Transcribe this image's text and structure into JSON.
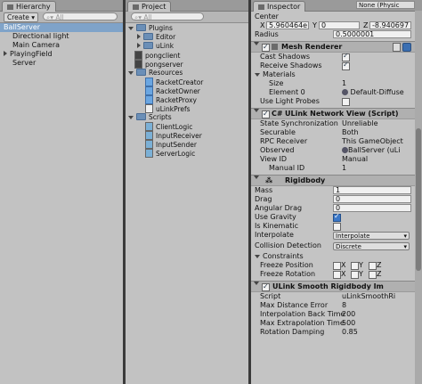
{
  "hierarchy": {
    "tab": "Hierarchy",
    "create": "Create",
    "search_placeholder": "All",
    "items": [
      "BallServer",
      "Directional light",
      "Main Camera",
      "PlayingField",
      "Server"
    ]
  },
  "project": {
    "tab": "Project",
    "create": "Create",
    "search_placeholder": "All",
    "items": [
      "Plugins",
      "Editor",
      "uLink",
      "pongclient",
      "pongserver",
      "Resources",
      "RacketCreator",
      "RacketOwner",
      "RacketProxy",
      "uLinkPrefs",
      "Scripts",
      "ClientLogic",
      "InputReceiver",
      "InputSender",
      "ServerLogic"
    ]
  },
  "inspector": {
    "tab": "Inspector",
    "top_text": "None (Physic Mate",
    "center_label": "Center",
    "center": {
      "x_label": "X",
      "x": "5.960464e",
      "y_label": "Y",
      "y": "0",
      "z_label": "Z",
      "z": "-8.940697"
    },
    "radius_label": "Radius",
    "radius": "0.5000001",
    "mesh_renderer": {
      "title": "Mesh Renderer",
      "cast_shadows": "Cast Shadows",
      "receive_shadows": "Receive Shadows",
      "materials": "Materials",
      "size_label": "Size",
      "size": "1",
      "element0_label": "Element 0",
      "element0": "Default-Diffuse",
      "use_light_probes": "Use Light Probes"
    },
    "network_view": {
      "title": "ULink Network View (Script)",
      "state_sync_label": "State Synchronization",
      "state_sync": "Unreliable",
      "securable_label": "Securable",
      "securable": "Both",
      "rpc_label": "RPC Receiver",
      "rpc": "This GameObject",
      "observed_label": "Observed",
      "observed": "BallServer (uLi",
      "viewid_label": "View ID",
      "viewid": "Manual",
      "manualid_label": "Manual ID",
      "manualid": "1"
    },
    "rigidbody": {
      "title": "Rigidbody",
      "mass_label": "Mass",
      "mass": "1",
      "drag_label": "Drag",
      "drag": "0",
      "angular_label": "Angular Drag",
      "angular": "0",
      "gravity_label": "Use Gravity",
      "kinematic_label": "Is Kinematic",
      "interp_label": "Interpolate",
      "interp": "Interpolate",
      "collision_label": "Collision Detection",
      "collision": "Discrete",
      "constraints_label": "Constraints",
      "freeze_pos_label": "Freeze Position",
      "freeze_rot_label": "Freeze Rotation",
      "x": "X",
      "y": "Y",
      "z": "Z"
    },
    "smooth": {
      "title": "ULink Smooth Rigidbody Im",
      "script_label": "Script",
      "script": "uLinkSmoothRi",
      "maxdist_label": "Max Distance Error",
      "maxdist": "8",
      "interpback_label": "Interpolation Back Time",
      "interpback": "200",
      "maxextra_label": "Max Extrapolation Time",
      "maxextra": "500",
      "rotdamp_label": "Rotation Damping",
      "rotdamp": "0.85"
    }
  }
}
